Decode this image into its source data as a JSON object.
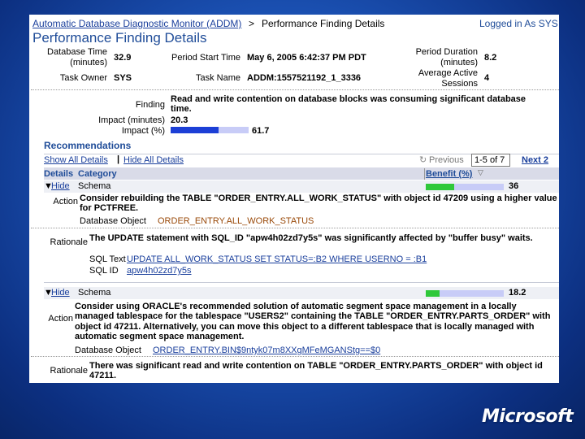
{
  "breadcrumb": {
    "addm_link": "Automatic Database Diagnostic Monitor (ADDM)",
    "separator": ">",
    "current": "Performance Finding Details",
    "logged_in": "Logged in As SYS"
  },
  "page_title": "Performance Finding Details",
  "summary": {
    "db_time_label": "Database Time",
    "db_time_unit": "(minutes)",
    "db_time_value": "32.9",
    "period_start_label": "Period Start Time",
    "period_start_value": "May 6, 2005 6:42:37 PM PDT",
    "period_duration_label": "Period Duration",
    "period_duration_unit": "(minutes)",
    "period_duration_value": "8.2",
    "task_owner_label": "Task Owner",
    "task_owner_value": "SYS",
    "task_name_label": "Task Name",
    "task_name_value": "ADDM:1557521192_1_3336",
    "avg_active_label": "Average Active",
    "avg_active_label2": "Sessions",
    "avg_active_value": "4"
  },
  "finding": {
    "label": "Finding",
    "text": "Read and write contention on database blocks was consuming significant database time.",
    "impact_minutes_label": "Impact (minutes)",
    "impact_minutes_value": "20.3",
    "impact_pct_label": "Impact (%)",
    "impact_pct_value": "61.7",
    "impact_pct_fraction": 0.617
  },
  "recommendations": {
    "heading": "Recommendations",
    "show_all": "Show All Details",
    "separator": "|",
    "hide_all": "Hide All Details",
    "previous_icon": "refresh-circle-icon",
    "previous": "Previous",
    "pager_value": "1-5 of 7",
    "next": "Next 2",
    "columns": {
      "details": "Details",
      "category": "Category",
      "benefit": "Benefit (%)"
    },
    "items": [
      {
        "hide": "Hide",
        "category": "Schema",
        "benefit": "36",
        "benefit_fraction": 0.36,
        "action_label": "Action",
        "action_text": "Consider rebuilding the TABLE \"ORDER_ENTRY.ALL_WORK_STATUS\" with object id 47209 using a higher value for PCTFREE.",
        "object_label": "Database Object",
        "object_value": "ORDER_ENTRY.ALL_WORK_STATUS",
        "rationale_label": "Rationale",
        "rationale_text": "The UPDATE statement with SQL_ID \"apw4h02zd7y5s\" was significantly affected by \"buffer busy\" waits.",
        "sql_text_label": "SQL Text",
        "sql_text_value": "UPDATE ALL_WORK_STATUS SET STATUS=:B2 WHERE USERNO = :B1",
        "sql_id_label": "SQL ID",
        "sql_id_value": "apw4h02zd7y5s"
      },
      {
        "hide": "Hide",
        "category": "Schema",
        "benefit": "18.2",
        "benefit_fraction": 0.182,
        "action_label": "Action",
        "action_text": "Consider using ORACLE's recommended solution of automatic segment space management in a locally managed tablespace for the tablespace \"USERS2\" containing the TABLE \"ORDER_ENTRY.PARTS_ORDER\" with object id 47211. Alternatively, you can move this object to a different tablespace that is locally managed with automatic segment space management.",
        "object_label": "Database Object",
        "object_value": "ORDER_ENTRY.BIN$9ntyk07m8XXgMFeMGANStg==$0",
        "rationale_label": "Rationale",
        "rationale_text": "There was significant read and write contention on TABLE \"ORDER_ENTRY.PARTS_ORDER\" with object id 47211."
      }
    ]
  },
  "footer": {
    "logo_text": "Microsoft"
  },
  "colors": {
    "link": "#1a3f9c",
    "title": "#1f4c98",
    "impact_fill": "#1c3fd6",
    "benefit_fill": "#2fc83a",
    "bar_track": "#c8ccf7",
    "background": "#1a4fb0"
  }
}
